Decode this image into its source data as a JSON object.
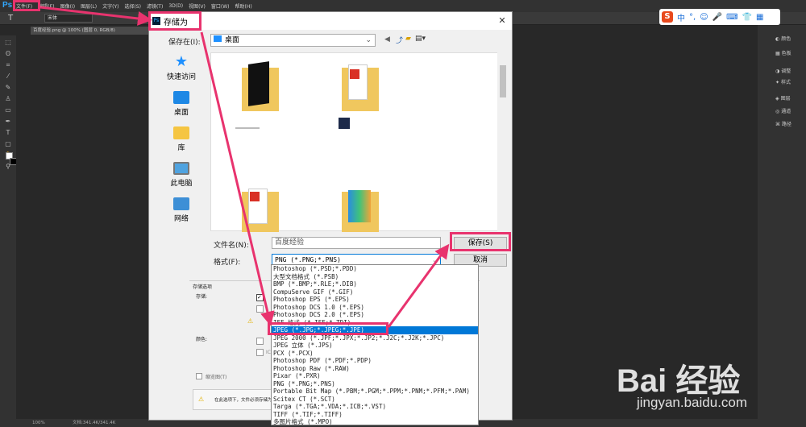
{
  "app": {
    "logo": "Ps",
    "menu": [
      "文件(F)",
      "编辑(E)",
      "图像(I)",
      "图层(L)",
      "文字(Y)",
      "选择(S)",
      "滤镜(T)",
      "3D(D)",
      "视图(V)",
      "窗口(W)",
      "帮助(H)"
    ],
    "font_name": "宋体",
    "doc_tab": "百度经验.png @ 100% (图层 0, RGB/8)",
    "status_zoom": "100%",
    "status_doc": "文档:341.4K/341.4K",
    "status_bottom": "时间轴",
    "right_panel": [
      "颜色",
      "色板",
      "调整",
      "样式",
      "图层",
      "通道",
      "路径"
    ]
  },
  "ime": {
    "brand": "S",
    "mode": "中"
  },
  "dialog": {
    "title": "存储为",
    "save_in_label": "保存在(I):",
    "save_in_value": "桌面",
    "nav": [
      "快速访问",
      "桌面",
      "库",
      "此电脑",
      "网络"
    ],
    "filename_label": "文件名(N):",
    "filename_value": "百度经验",
    "format_label": "格式(F):",
    "format_value": "PNG (*.PNG;*.PNS)",
    "save_button": "保存(S)",
    "cancel_button": "取消",
    "options_title": "存储选项",
    "options_save_label": "存储:",
    "options_color_label": "颜色:",
    "options_color_value": "ICC",
    "thumbnail_label": "缩览图(T)",
    "warning_text": "在此选项下，文件必须存储为",
    "format_options": [
      "Photoshop (*.PSD;*.PDD)",
      "大型文档格式 (*.PSB)",
      "BMP (*.BMP;*.RLE;*.DIB)",
      "CompuServe GIF (*.GIF)",
      "Photoshop EPS (*.EPS)",
      "Photoshop DCS 1.0 (*.EPS)",
      "Photoshop DCS 2.0 (*.EPS)",
      "IFF 格式 (*.IFF;*.TDI)",
      "JPEG (*.JPG;*.JPEG;*.JPE)",
      "JPEG 2000 (*.JPF;*.JPX;*.JP2;*.J2C;*.J2K;*.JPC)",
      "JPEG 立体 (*.JPS)",
      "PCX (*.PCX)",
      "Photoshop PDF (*.PDF;*.PDP)",
      "Photoshop Raw (*.RAW)",
      "Pixar (*.PXR)",
      "PNG (*.PNG;*.PNS)",
      "Portable Bit Map (*.PBM;*.PGM;*.PPM;*.PNM;*.PFM;*.PAM)",
      "Scitex CT (*.SCT)",
      "Targa (*.TGA;*.VDA;*.ICB;*.VST)",
      "TIFF (*.TIF;*.TIFF)",
      "多图片格式 (*.MPO)"
    ],
    "selected_index": 8
  },
  "watermark": {
    "logo": "Bai 经验",
    "url": "jingyan.baidu.com"
  },
  "colors": {
    "highlight": "#e8336e",
    "selection": "#0078d7",
    "ps_blue": "#31a8ff"
  }
}
